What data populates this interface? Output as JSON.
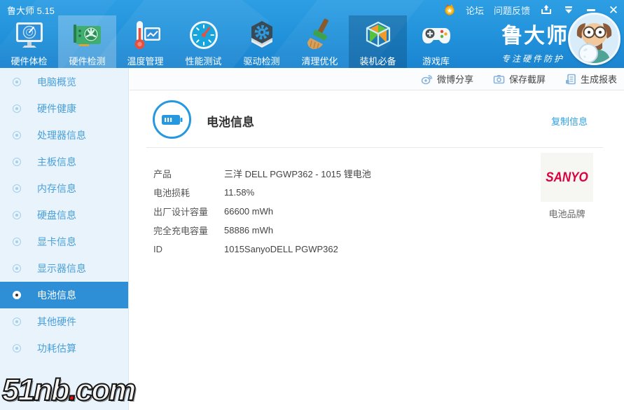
{
  "window": {
    "title": "鲁大师 5.15"
  },
  "titlebar": {
    "forum_label": "论坛",
    "feedback_label": "问题反馈"
  },
  "nav": {
    "items": [
      {
        "label": "硬件体检"
      },
      {
        "label": "硬件检测"
      },
      {
        "label": "温度管理"
      },
      {
        "label": "性能测试"
      },
      {
        "label": "驱动检测"
      },
      {
        "label": "清理优化"
      },
      {
        "label": "装机必备"
      },
      {
        "label": "游戏库"
      }
    ]
  },
  "logo": {
    "name": "鲁大师",
    "slogan": "专注硬件防护"
  },
  "toolbar": {
    "buttons": [
      {
        "label": "微博分享"
      },
      {
        "label": "保存截屏"
      },
      {
        "label": "生成报表"
      }
    ]
  },
  "sidebar": {
    "items": [
      {
        "label": "电脑概览",
        "selected": false
      },
      {
        "label": "硬件健康",
        "selected": false
      },
      {
        "label": "处理器信息",
        "selected": false
      },
      {
        "label": "主板信息",
        "selected": false
      },
      {
        "label": "内存信息",
        "selected": false
      },
      {
        "label": "硬盘信息",
        "selected": false
      },
      {
        "label": "显卡信息",
        "selected": false
      },
      {
        "label": "显示器信息",
        "selected": false
      },
      {
        "label": "电池信息",
        "selected": true
      },
      {
        "label": "其他硬件",
        "selected": false
      },
      {
        "label": "功耗估算",
        "selected": false
      }
    ]
  },
  "content": {
    "title": "电池信息",
    "copy_link": "复制信息",
    "rows": [
      {
        "label": "产品",
        "value": "三洋 DELL PGWP362 - 1015 锂电池"
      },
      {
        "label": "电池损耗",
        "value": "11.58%"
      },
      {
        "label": "出厂设计容量",
        "value": "66600 mWh"
      },
      {
        "label": "完全充电容量",
        "value": "58886 mWh"
      },
      {
        "label": "ID",
        "value": "1015SanyoDELL PGWP362"
      }
    ],
    "brand": {
      "logo_text": "SANYO",
      "logo_color": "#dd0040",
      "caption": "电池品牌"
    }
  },
  "watermark": {
    "prefix": "51nb",
    "dot": ".",
    "suffix": "com"
  },
  "colors": {
    "accent": "#2598e0",
    "selected_nav": "#2e8fd6",
    "header": "#2191da"
  }
}
